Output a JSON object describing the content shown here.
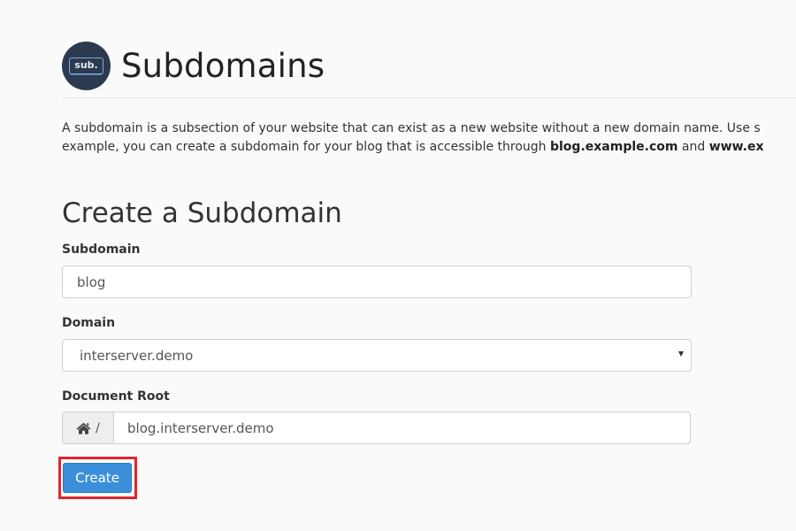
{
  "header": {
    "logo_text": "sub.",
    "title": "Subdomains"
  },
  "intro": {
    "line1": "A subdomain is a subsection of your website that can exist as a new website without a new domain name. Use s",
    "line2_prefix": "example, you can create a subdomain for your blog that is accessible through ",
    "line2_bold1": "blog.example.com",
    "line2_mid": " and ",
    "line2_bold2": "www.ex"
  },
  "form": {
    "section_title": "Create a Subdomain",
    "subdomain": {
      "label": "Subdomain",
      "value": "blog"
    },
    "domain": {
      "label": "Domain",
      "selected": "interserver.demo"
    },
    "document_root": {
      "label": "Document Root",
      "prefix": "/",
      "value": "blog.interserver.demo"
    },
    "create_button": "Create"
  },
  "colors": {
    "button": "#3b8fd8",
    "highlight": "#e0252e",
    "logo_bg": "#2b3a4e"
  }
}
